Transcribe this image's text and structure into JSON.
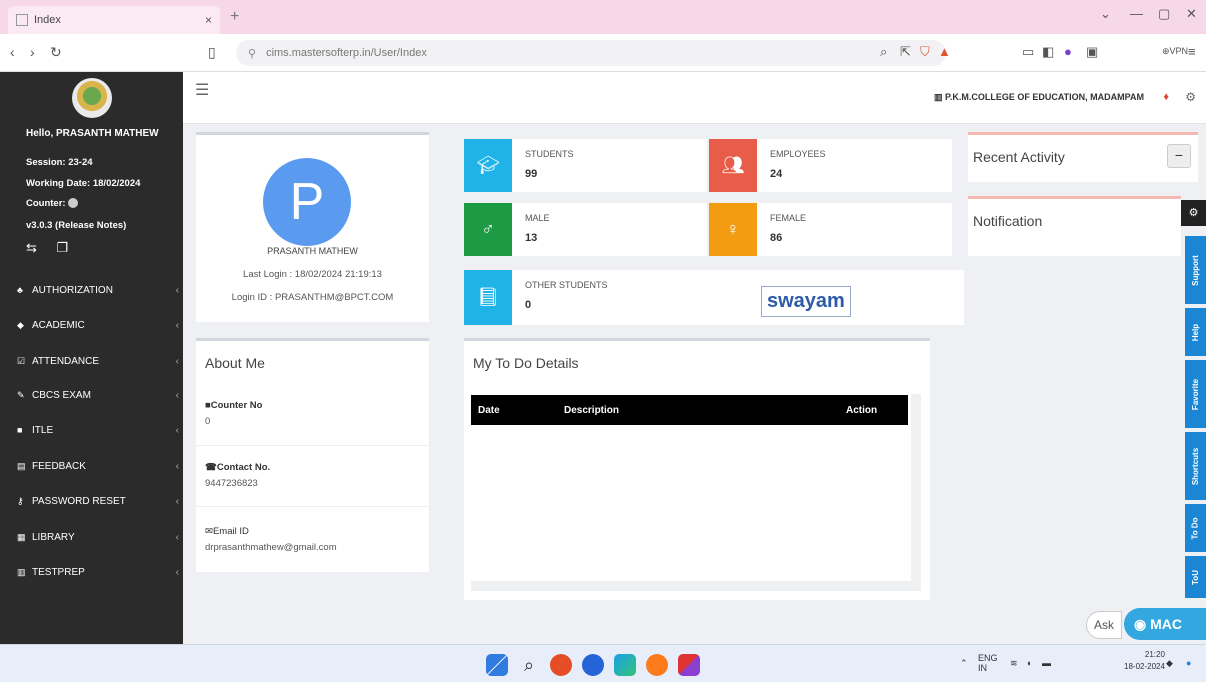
{
  "browser": {
    "tab_title": "Index",
    "tab_close": "×",
    "new_tab": "+",
    "url": "cims.mastersofterp.in/User/Index",
    "vpn_label": "⊕VPN",
    "win_minimize": "—",
    "win_maximize": "▢",
    "win_close": "✕"
  },
  "sidebar": {
    "greeting": "Hello, PRASANTH MATHEW",
    "session": "Session: 23-24",
    "working_date": "Working Date: 18/02/2024",
    "counter": "Counter:",
    "version": "v3.0.3 (Release Notes)",
    "menu": [
      {
        "label": "AUTHORIZATION",
        "icon": "users-icon"
      },
      {
        "label": "ACADEMIC",
        "icon": "graduation-cap-icon"
      },
      {
        "label": "ATTENDANCE",
        "icon": "check-square-icon"
      },
      {
        "label": "CBCS EXAM",
        "icon": "edit-icon"
      },
      {
        "label": "ITLE",
        "icon": "book-icon"
      },
      {
        "label": "FEEDBACK",
        "icon": "list-icon"
      },
      {
        "label": "PASSWORD RESET",
        "icon": "key-icon"
      },
      {
        "label": "LIBRARY",
        "icon": "building-icon"
      },
      {
        "label": "TESTPREP",
        "icon": "file-icon"
      }
    ]
  },
  "header": {
    "college": "P.K.M.COLLEGE OF EDUCATION, MADAMPAM"
  },
  "profile": {
    "initial": "P",
    "name": "PRASANTH MATHEW",
    "last_login": "Last Login : 18/02/2024 21:19:13",
    "login_id": "Login ID : PRASANTHM@BPCT.COM"
  },
  "about": {
    "title": "About Me",
    "counter_label": "Counter No",
    "counter_value": "0",
    "contact_label": "Contact No.",
    "contact_value": "9447236823",
    "email_label": "Email ID",
    "email_value": "drprasanthmathew@gmail.com"
  },
  "stats": [
    {
      "label": "STUDENTS",
      "value": "99",
      "color": "#1fb3e8",
      "icon": "graduation-cap-icon"
    },
    {
      "label": "EMPLOYEES",
      "value": "24",
      "color": "#e85c4a",
      "icon": "users-icon"
    },
    {
      "label": "MALE",
      "value": "13",
      "color": "#1c9a44",
      "icon": "male-icon"
    },
    {
      "label": "FEMALE",
      "value": "86",
      "color": "#f39c12",
      "icon": "female-icon"
    },
    {
      "label": "OTHER STUDENTS",
      "value": "0",
      "color": "#1fb3e8",
      "icon": "book-icon"
    }
  ],
  "swayam": "swayam",
  "todo": {
    "title": "My To Do Details",
    "columns": [
      "Date",
      "Description",
      "Action"
    ]
  },
  "right": {
    "recent_activity": "Recent Activity",
    "notification": "Notification",
    "collapse": "−"
  },
  "side_tabs": [
    "Support",
    "Help",
    "Favorite",
    "Shortcuts",
    "To Do",
    "ToU"
  ],
  "chat": {
    "ask": "Ask",
    "brand": "MAC"
  },
  "taskbar": {
    "lang_top": "ENG",
    "lang_bottom": "IN",
    "time": "21:20",
    "date": "18-02-2024"
  }
}
